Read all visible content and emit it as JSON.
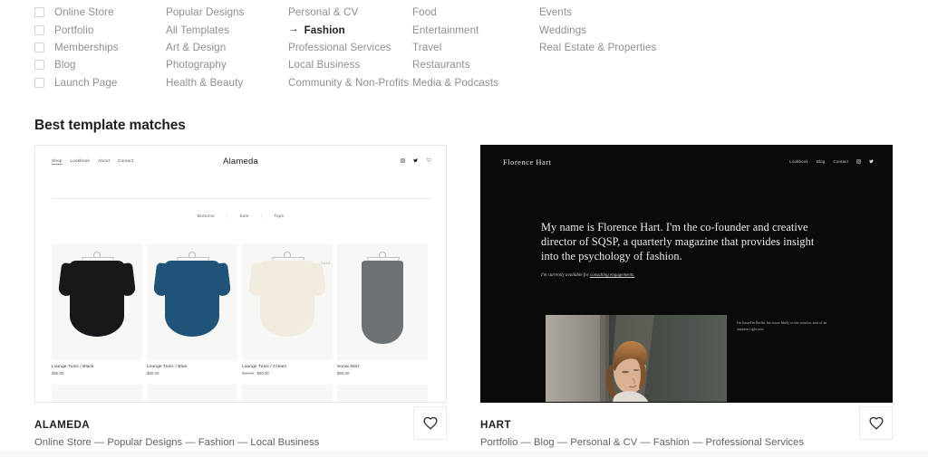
{
  "filters": {
    "checkbox_column": [
      {
        "label": "Online Store",
        "checked": false
      },
      {
        "label": "Portfolio",
        "checked": false
      },
      {
        "label": "Memberships",
        "checked": false
      },
      {
        "label": "Blog",
        "checked": false
      },
      {
        "label": "Launch Page",
        "checked": false
      }
    ],
    "column_b": [
      "Popular Designs",
      "All Templates",
      "Art & Design",
      "Photography",
      "Health & Beauty"
    ],
    "column_c": [
      "Personal & CV",
      "Fashion",
      "Professional Services",
      "Local Business",
      "Community & Non-Profits"
    ],
    "column_d": [
      "Food",
      "Entertainment",
      "Travel",
      "Restaurants",
      "Media & Podcasts"
    ],
    "column_e": [
      "Events",
      "Weddings",
      "Real Estate & Properties"
    ],
    "active_item": "Fashion",
    "active_arrow": "→"
  },
  "section": {
    "title": "Best template matches"
  },
  "cards": [
    {
      "name": "ALAMEDA",
      "tags": "Online Store  —  Popular Designs  —  Fashion  —  Local Business",
      "favorite_icon": "heart-icon",
      "preview": {
        "brand": "Alameda",
        "nav": [
          "Shop",
          "Lookbook",
          "About",
          "Contact"
        ],
        "social": [
          "instagram-icon",
          "twitter-icon",
          "cart-icon"
        ],
        "categories": [
          "Bottoms",
          "Sale",
          "Tops"
        ],
        "separator": "|",
        "products": [
          {
            "title": "Lounge Tunic / Black",
            "price": "$50.00",
            "original_price": "",
            "sale_badge": "",
            "color": "#17181a"
          },
          {
            "title": "Lounge Tunic / Blue",
            "price": "$50.00",
            "original_price": "",
            "sale_badge": "",
            "color": "#1f5377"
          },
          {
            "title": "Lounge Tunic / Cream",
            "price": "$50.00",
            "original_price": "$60.00",
            "sale_badge": "SALE",
            "color": "#f2ecdf"
          },
          {
            "title": "Sonia Skirt",
            "price": "$50.00",
            "original_price": "",
            "sale_badge": "",
            "color": "#6e7174"
          }
        ]
      }
    },
    {
      "name": "HART",
      "tags": "Portfolio  —  Blog  —  Personal & CV  —  Fashion  —  Professional Services",
      "favorite_icon": "heart-icon",
      "preview": {
        "brand": "Florence Hart",
        "nav": [
          "Lookbook",
          "Blog",
          "Contact"
        ],
        "social": [
          "instagram-icon",
          "twitter-icon"
        ],
        "headline": "My name is Florence Hart. I'm the co-founder and creative director of SQSP, a quarterly magazine that provides insight into the psychology of fashion.",
        "subline_prefix": "I'm currently available for ",
        "subline_link": "consulting engagements.",
        "caption": "I'm based in Berlin, but more likely in the window seat of an airplane right now."
      }
    }
  ],
  "colors": {
    "text_primary": "#1d1f21",
    "text_muted": "#8c8f93",
    "tag_text": "#5d6166",
    "dark_preview_bg": "#0a0a0a",
    "card_border": "#e6e8ea"
  }
}
